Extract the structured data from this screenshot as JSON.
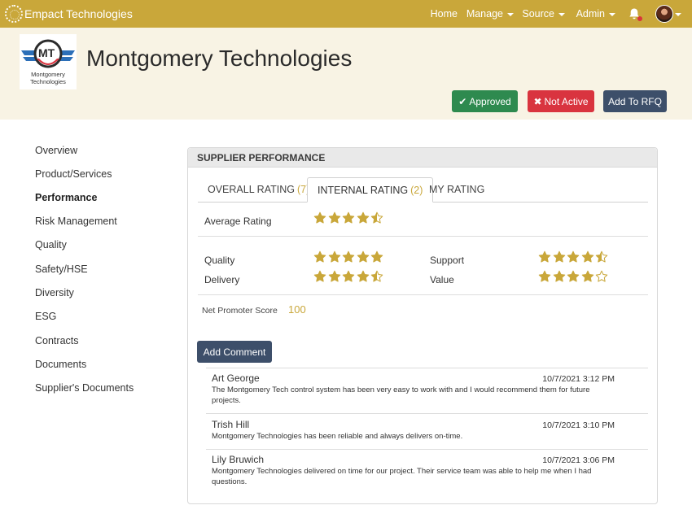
{
  "app": {
    "name": "Empact Technologies"
  },
  "nav": {
    "home": "Home",
    "manage": "Manage",
    "source": "Source",
    "admin": "Admin"
  },
  "icons": {
    "brand": "empact-ring-logo-icon",
    "bell": "bell-icon",
    "avatar": "user-avatar",
    "star": "star-icon"
  },
  "colors": {
    "brand": "#c9a73a",
    "header_bg": "#f8f3e4",
    "approved": "#2e8a4f",
    "not_active": "#d9343f",
    "primary": "#3d4f6a",
    "star": "#c9a73a"
  },
  "company": {
    "name": "Montgomery Technologies",
    "logo_initials": "MT",
    "logo_caption_line1": "Montgomery",
    "logo_caption_line2": "Technologies"
  },
  "actions": {
    "approved": "Approved",
    "not_active": "Not Active",
    "add_to_rfq": "Add To RFQ"
  },
  "sidebar": {
    "items": [
      {
        "label": "Overview",
        "active": false
      },
      {
        "label": "Product/Services",
        "active": false
      },
      {
        "label": "Performance",
        "active": true
      },
      {
        "label": "Risk Management",
        "active": false
      },
      {
        "label": "Quality",
        "active": false
      },
      {
        "label": "Safety/HSE",
        "active": false
      },
      {
        "label": "Diversity",
        "active": false
      },
      {
        "label": "ESG",
        "active": false
      },
      {
        "label": "Contracts",
        "active": false
      },
      {
        "label": "Documents",
        "active": false
      },
      {
        "label": "Supplier's Documents",
        "active": false
      }
    ]
  },
  "panel": {
    "title": "SUPPLIER PERFORMANCE",
    "tabs": [
      {
        "label": "OVERALL RATING",
        "count": "(7)",
        "active": false
      },
      {
        "label": "INTERNAL RATING",
        "count": "(2)",
        "active": true
      },
      {
        "label": "MY RATING",
        "count": "",
        "active": false
      }
    ],
    "average": {
      "label": "Average Rating",
      "rating": 4.5
    },
    "metrics": [
      {
        "label": "Quality",
        "rating": 5
      },
      {
        "label": "Delivery",
        "rating": 4.5
      },
      {
        "label": "Support",
        "rating": 4.5
      },
      {
        "label": "Value",
        "rating": 4
      }
    ],
    "nps": {
      "label": "Net Promoter Score",
      "value": "100"
    },
    "add_comment": "Add Comment"
  },
  "comments": [
    {
      "author": "Art George",
      "date": "10/7/2021 3:12 PM",
      "text": "The Montgomery Tech control system has been very easy to work with and I would recommend them for future projects."
    },
    {
      "author": "Trish Hill",
      "date": "10/7/2021 3:10 PM",
      "text": "Montgomery Technologies has been reliable and always delivers on-time."
    },
    {
      "author": "Lily Bruwich",
      "date": "10/7/2021 3:06 PM",
      "text": "Montgomery Technologies delivered on time for our project. Their service team was able to help me when I had questions."
    }
  ]
}
